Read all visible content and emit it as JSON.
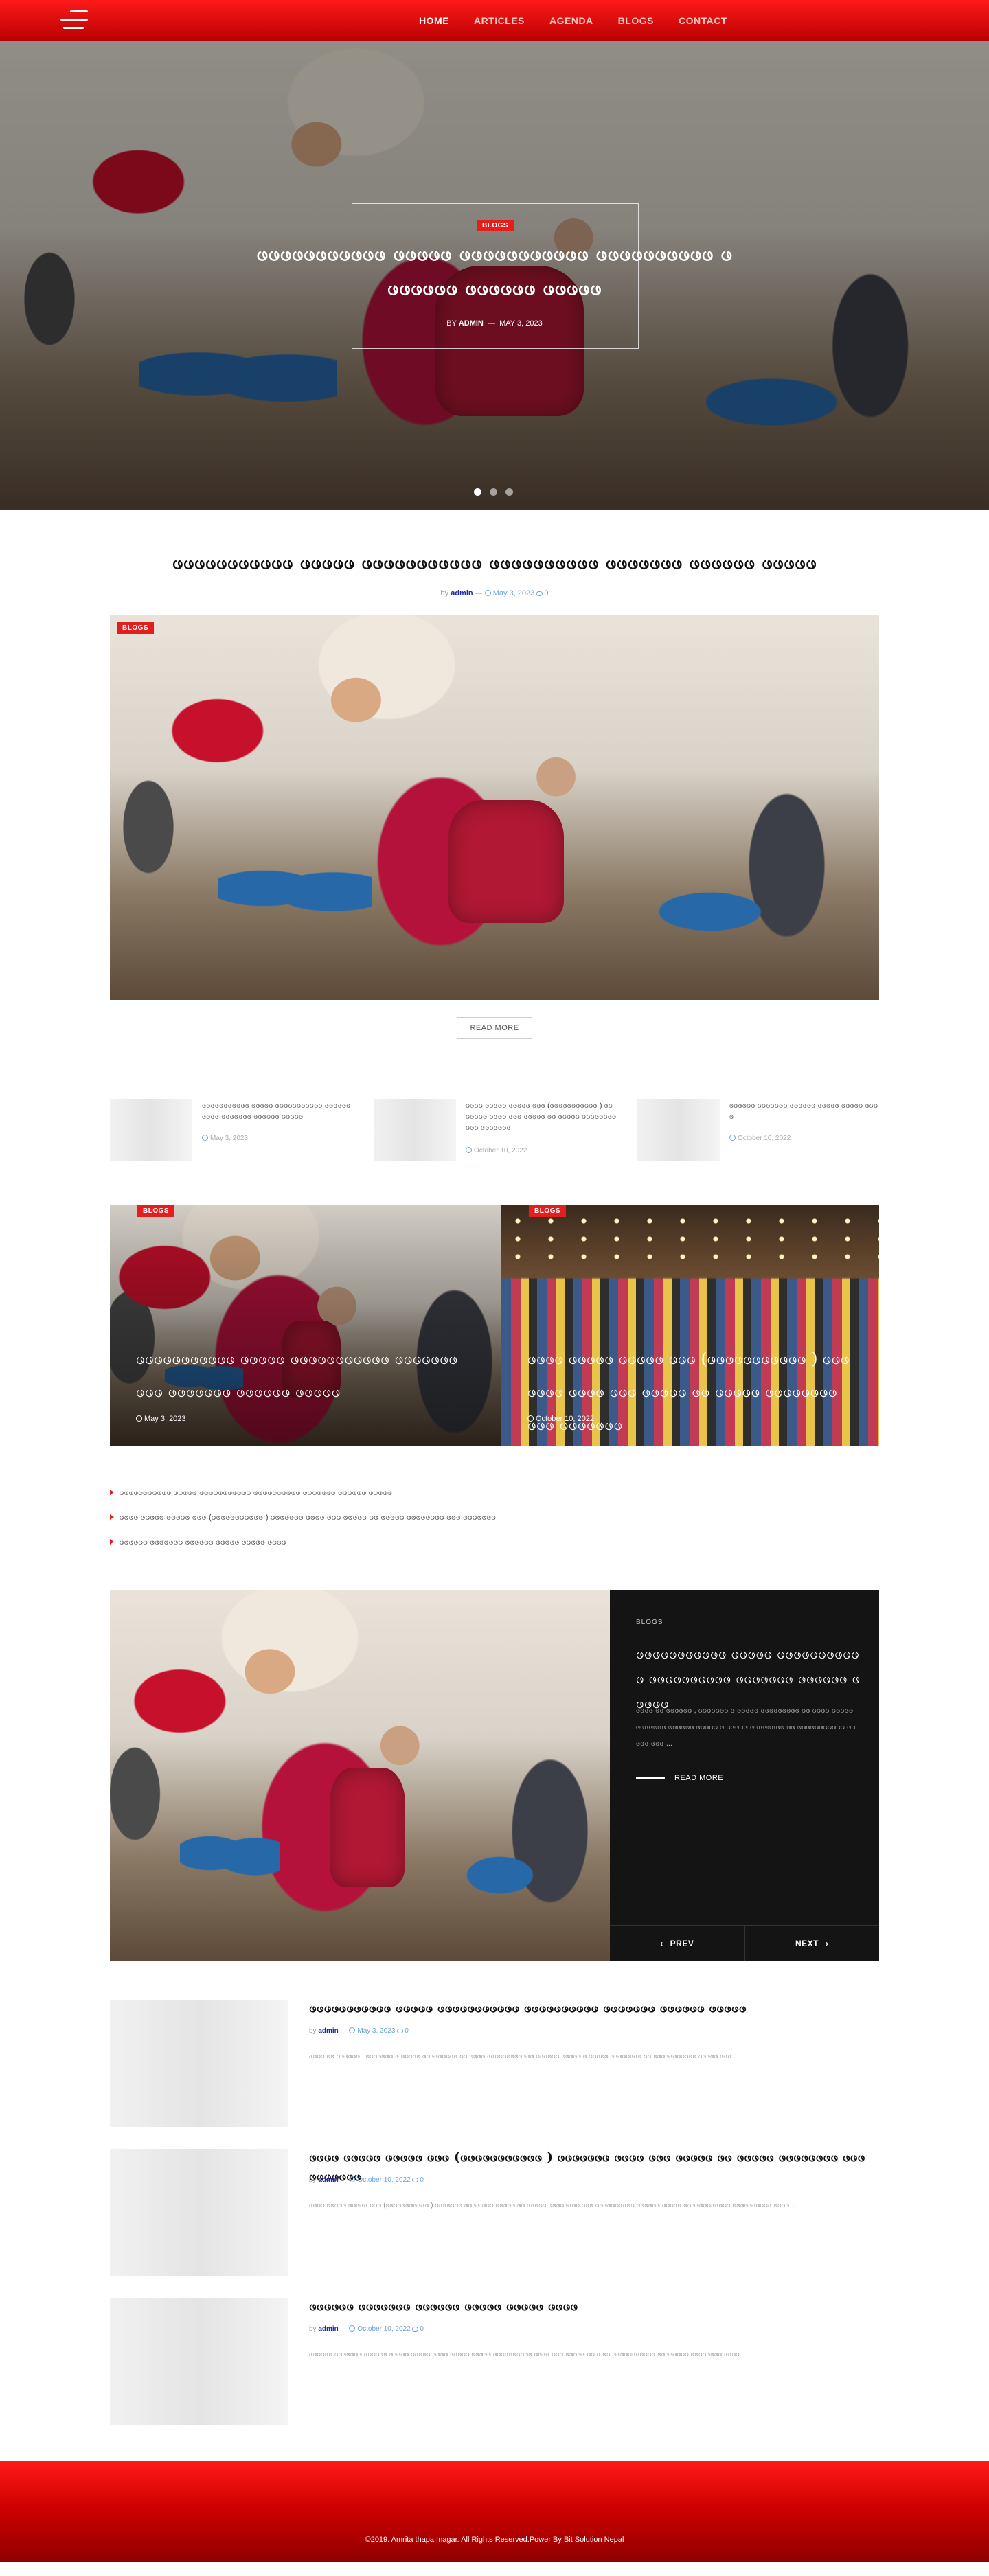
{
  "nav": {
    "items": [
      "HOME",
      "ARTICLES",
      "AGENDA",
      "BLOGS",
      "CONTACT"
    ]
  },
  "hero": {
    "badge": "BLOGS",
    "title": "ဖဖဖဖဖဖဖဖဖဖဖ ဖဖဖဖဖ ဖဖဖဖဖဖဖဖဖဖဖ ဖဖဖဖဖဖဖဖဖဖ ဖဖဖဖဖဖဖ ဖဖဖဖဖဖ ဖဖဖဖဖ",
    "by": "BY",
    "author": "ADMIN",
    "sep": "—",
    "date": "MAY 3, 2023",
    "slides": 3,
    "active_slide": 1
  },
  "featured": {
    "title": "ဖဖဖဖဖဖဖဖဖဖဖ ဖဖဖဖဖ ဖဖဖဖဖဖဖဖဖဖဖ ဖဖဖဖဖဖဖဖဖဖ ဖဖဖဖဖဖဖ ဖဖဖဖဖဖ ဖဖဖဖဖ",
    "by": "by",
    "author": "admin",
    "sep": "—",
    "date": "May 3, 2023",
    "comments": "0",
    "badge": "BLOGS",
    "read_more": "READ MORE"
  },
  "small_posts": [
    {
      "title": "ဖဖဖဖဖဖဖဖဖဖဖ ဖဖဖဖဖ ဖဖဖဖဖဖဖဖဖဖဖ ဖဖဖဖဖဖဖဖဖဖ ဖဖဖဖဖဖဖ ဖဖဖဖဖဖ ဖဖဖဖဖ",
      "date": "May 3, 2023"
    },
    {
      "title": "ဖဖဖဖ ဖဖဖဖဖ ဖဖဖဖဖ ဖဖဖ (ဖဖဖဖဖဖဖဖဖဖဖ ) ဖဖဖဖဖဖဖ ဖဖဖဖ ဖဖဖ ဖဖဖဖဖ ဖဖ ဖဖဖဖဖ ဖဖဖဖဖဖဖဖ ဖဖဖ ဖဖဖဖဖဖဖ",
      "date": "October 10, 2022"
    },
    {
      "title": "ဖဖဖဖဖဖ ဖဖဖဖဖဖဖ ဖဖဖဖဖဖ ဖဖဖဖဖ ဖဖဖဖဖ ဖဖဖဖ",
      "date": "October 10, 2022"
    }
  ],
  "overlay_cards": [
    {
      "badge": "BLOGS",
      "title": "ဖဖဖဖဖဖဖဖဖဖဖ ဖဖဖဖဖ ဖဖဖဖဖဖဖဖဖဖဖ ဖဖဖဖဖဖဖဖဖဖ ဖဖဖဖဖဖဖ ဖဖဖဖဖဖ ဖဖဖဖဖ",
      "date": "May 3, 2023"
    },
    {
      "badge": "BLOGS",
      "title": "ဖဖဖဖ ဖဖဖဖဖ ဖဖဖဖဖ ဖဖဖ (ဖဖဖဖဖဖဖဖဖဖဖ ) ဖဖဖဖဖဖဖ ဖဖဖဖ ဖဖဖ ဖဖဖဖဖ ဖဖ ဖဖဖဖဖ ဖဖဖဖဖဖဖဖ ဖဖဖ ဖဖဖဖဖဖဖ",
      "date": "October 10, 2022"
    }
  ],
  "bullets": [
    "ဖဖဖဖဖဖဖဖဖဖဖ ဖဖဖဖဖ ဖဖဖဖဖဖဖဖဖဖဖ ဖဖဖဖဖဖဖဖဖဖ ဖဖဖဖဖဖဖ ဖဖဖဖဖဖ ဖဖဖဖဖ",
    "ဖဖဖဖ ဖဖဖဖဖ ဖဖဖဖဖ ဖဖဖ (ဖဖဖဖဖဖဖဖဖဖဖ ) ဖဖဖဖဖဖဖ ဖဖဖဖ ဖဖဖ ဖဖဖဖဖ ဖဖ ဖဖဖဖဖ ဖဖဖဖဖဖဖဖ ဖဖဖ ဖဖဖဖဖဖဖ",
    "ဖဖဖဖဖဖ ဖဖဖဖဖဖဖ ဖဖဖဖဖဖ ဖဖဖဖဖ ဖဖဖဖဖ ဖဖဖဖ"
  ],
  "slider": {
    "category": "BLOGS",
    "title": "ဖဖဖဖဖဖဖဖဖဖဖ ဖဖဖဖဖ ဖဖဖဖဖဖဖဖဖဖဖ ဖဖဖဖဖဖဖဖဖဖ ဖဖဖဖဖဖဖ ဖဖဖဖဖဖ ဖဖဖဖဖ",
    "excerpt": "ဖဖဖဖ ဖဖ ဖဖဖဖဖဖ , ဖဖဖဖဖဖဖ ဖ ဖဖဖဖဖ ဖဖဖဖဖဖဖဖဖ ဖဖ ဖဖဖဖ ဖဖဖဖဖဖဖဖဖဖဖဖ ဖဖဖဖဖဖ ဖဖဖဖဖ ဖ ဖဖဖဖဖ ဖဖဖဖဖဖဖဖ ဖဖ ဖဖဖဖဖဖဖဖဖဖဖ ဖဖဖဖဖ ဖဖဖ ...",
    "read_more": "READ MORE",
    "prev": "PREV",
    "next": "NEXT"
  },
  "list_posts": [
    {
      "title": "ဖဖဖဖဖဖဖဖဖဖဖ ဖဖဖဖဖ ဖဖဖဖဖဖဖဖဖဖဖ ဖဖဖဖဖဖဖဖဖဖ ဖဖဖဖဖဖဖ ဖဖဖဖဖဖ ဖဖဖဖဖ",
      "by": "by",
      "author": "admin",
      "sep": "—",
      "date": "May 3, 2023",
      "comments": "0",
      "excerpt": "ဖဖဖဖ ဖဖ ဖဖဖဖဖဖ , ဖဖဖဖဖဖဖ ဖ ဖဖဖဖဖ ဖဖဖဖဖဖဖဖဖ ဖဖ ဖဖဖဖ ဖဖဖဖဖဖဖဖဖဖဖဖ ဖဖဖဖဖဖ ဖဖဖဖဖ ဖ ဖဖဖဖဖ ဖဖဖဖဖဖဖဖ ဖဖ ဖဖဖဖဖဖဖဖဖဖဖ ဖဖဖဖဖ ဖဖဖ..."
    },
    {
      "title": "ဖဖဖဖ ဖဖဖဖဖ ဖဖဖဖဖ ဖဖဖ (ဖဖဖဖဖဖဖဖဖဖဖ ) ဖဖဖဖဖဖဖ ဖဖဖဖ ဖဖဖ ဖဖဖဖဖ ဖဖ ဖဖဖဖဖ ဖဖဖဖဖဖဖဖ ဖဖဖ ဖဖဖဖဖဖဖ",
      "by": "by",
      "author": "admin",
      "sep": "—",
      "date": "October 10, 2022",
      "comments": "0",
      "excerpt": "ဖဖဖဖ ဖဖဖဖဖ ဖဖဖဖဖ ဖဖဖ (ဖဖဖဖဖဖဖဖဖဖဖ ) ဖဖဖဖဖဖဖ ဖဖဖဖ ဖဖဖ ဖဖဖဖဖ ဖဖ ဖဖဖဖဖ ဖဖဖဖဖဖဖဖ ဖဖဖ ဖဖဖဖဖဖဖဖဖဖ ဖဖဖဖဖဖ ဖဖဖဖဖ ဖဖဖဖဖဖဖဖဖဖဖဖ ဖဖဖဖဖဖဖဖဖဖ ဖဖဖဖ..."
    },
    {
      "title": "ဖဖဖဖဖဖ ဖဖဖဖဖဖဖ ဖဖဖဖဖဖ ဖဖဖဖဖ ဖဖဖဖဖ ဖဖဖဖ",
      "by": "by",
      "author": "admin",
      "sep": "—",
      "date": "October 10, 2022",
      "comments": "0",
      "excerpt": "ဖဖဖဖဖဖ ဖဖဖဖဖဖဖ ဖဖဖဖဖဖ ဖဖဖဖဖ ဖဖဖဖဖ ဖဖဖဖ ဖဖဖဖဖ ဖဖဖဖဖ ဖဖဖဖဖဖဖဖဖဖ ဖဖဖဖ ဖဖဖ ဖဖဖဖဖ ဖဖ ဖ ဖဖ ဖဖဖဖဖဖဖဖဖဖဖ ဖဖဖဖဖဖဖဖ ဖဖဖဖဖဖဖဖ ဖဖဖဖ..."
    }
  ],
  "footer": {
    "copyright": "©2019. Amrita thapa magar. All Rights Reserved.Power By Bit Solution Nepal"
  },
  "colors": {
    "brand_red": "#e41d1d",
    "header_red": "#c80000",
    "author_blue": "#1a2aa8",
    "meta_blue": "#6ba4d8",
    "panel_dark": "#141414"
  }
}
